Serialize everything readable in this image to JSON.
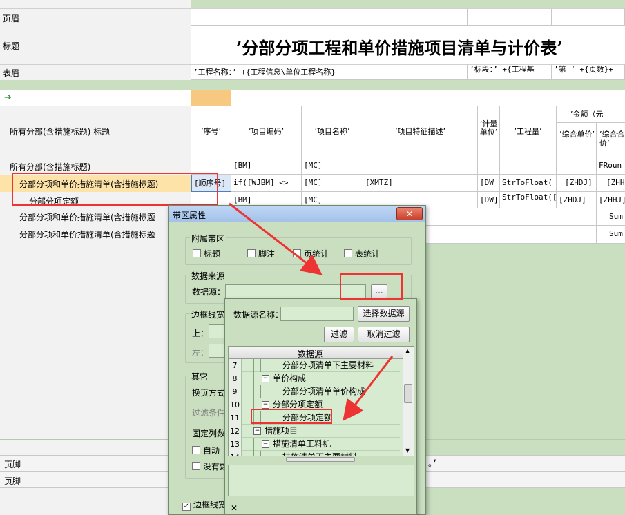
{
  "bands": {
    "page_header": "页眉",
    "title": "标题",
    "table_header": "表眉",
    "page_footer_1": "页脚",
    "page_footer_2": "页脚"
  },
  "report": {
    "title": "’分部分项工程和单价措施项目清单与计价表’",
    "project_name": "’工程名称：’ +{工程信息\\单位工程名称}",
    "section": "’标段：’ +{工程基",
    "page": "’第 ’ +{页数}+",
    "footer_fragment": "。’"
  },
  "columns": {
    "band_title": "所有分部(含措施标题) 标题",
    "seq": "’序号’",
    "code": "’项目编码’",
    "name": "’项目名称’",
    "feature": "’项目特征描述’",
    "unit": "’计量单位’",
    "qty": "’工程量’",
    "amount_group": "’金额（元",
    "unit_price": "’综合单价’",
    "total": "’综合合价’"
  },
  "rows": [
    {
      "band": "所有分部(含措施标题)",
      "code": "[BM]",
      "name": "[MC]",
      "total": "FRoun"
    },
    {
      "band": "分部分项和单价措施清单(含措施标题)",
      "seq": "[顺序号]",
      "code": "if([WJBM] <>",
      "name": "[MC]",
      "feature": "[XMTZ]",
      "unit": "[DW",
      "qty": "StrToFloat(",
      "price": "[ZHDJ]",
      "total": "[ZHH"
    },
    {
      "band": "分部分项定额",
      "code": "[BM]",
      "name": "[MC]",
      "unit": "[DW]",
      "qty": "StrToFloat([",
      "price": "[ZHDJ]",
      "total": "[ZHHJ]"
    },
    {
      "band": "分部分项和单价措施清单(含措施标题",
      "total": "Sum"
    },
    {
      "band": "分部分项和单价措施清单(含措施标题",
      "total": "Sum"
    }
  ],
  "dialog": {
    "title": "带区属性",
    "close": "✕",
    "attached_group": "附属带区",
    "chk_title": "标题",
    "chk_footnote": "脚注",
    "chk_page_total": "页统计",
    "chk_table_total": "表统计",
    "datasource_group": "数据来源",
    "datasource_label": "数据源：",
    "datasource_value": "",
    "browse_button": "...",
    "border_group": "边框线宽",
    "border_top": "上：",
    "border_left": "左：",
    "other_group": "其它",
    "page_break": "换页方式",
    "filter_cond": "过滤条件",
    "fixed_cols": "固定列数",
    "auto_chk": "自动",
    "none_chk": "没有数",
    "border_chk": "边框线宽"
  },
  "popup": {
    "name_label": "数据源名称：",
    "name_value": "",
    "select_button": "选择数据源",
    "filter_button": "过滤",
    "cancel_filter_button": "取消过滤",
    "tree_header": "数据源",
    "tree": [
      {
        "n": "7",
        "text": "分部分项清单下主要材料",
        "indent": 2,
        "toggle": false
      },
      {
        "n": "8",
        "text": "单价构成",
        "indent": 1,
        "toggle": true
      },
      {
        "n": "9",
        "text": "分部分项清单单价构成",
        "indent": 2,
        "toggle": false
      },
      {
        "n": "10",
        "text": "分部分项定额",
        "indent": 1,
        "toggle": true
      },
      {
        "n": "11",
        "text": "分部分项定额",
        "indent": 2,
        "toggle": false
      },
      {
        "n": "12",
        "text": "措施项目",
        "indent": 0,
        "toggle": true
      },
      {
        "n": "13",
        "text": "措施清单工料机",
        "indent": 1,
        "toggle": true
      },
      {
        "n": "14",
        "text": "措施清单下主要材料",
        "indent": 2,
        "toggle": false
      }
    ],
    "close_x": "✕"
  },
  "colors": {
    "accent_red": "#ee3333",
    "band_green": "#c9dfc0",
    "field_green": "#d7ecd0"
  }
}
